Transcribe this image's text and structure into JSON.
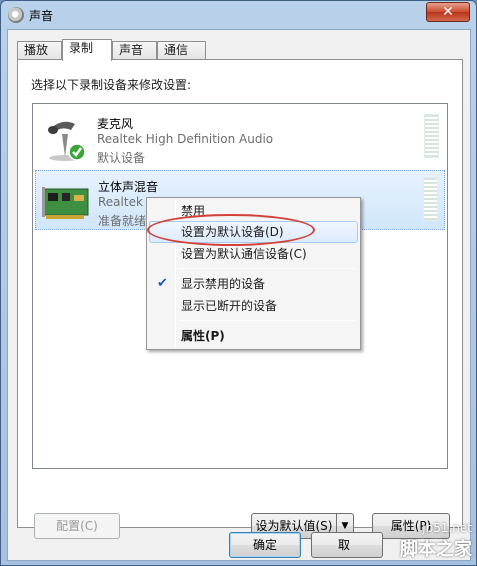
{
  "window": {
    "title": "声音",
    "close": "✕"
  },
  "tabs": [
    {
      "label": "播放",
      "active": false
    },
    {
      "label": "录制",
      "active": true
    },
    {
      "label": "声音",
      "active": false
    },
    {
      "label": "通信",
      "active": false
    }
  ],
  "instruction": "选择以下录制设备来修改设置:",
  "devices": [
    {
      "name": "麦克风",
      "driver": "Realtek High Definition Audio",
      "status": "默认设备",
      "icon": "microphone-icon"
    },
    {
      "name": "立体声混音",
      "driver": "Realtek",
      "status": "准备就绪",
      "icon": "sound-card-icon",
      "selected": true
    }
  ],
  "context_menu": {
    "items": [
      {
        "label": "禁用"
      },
      {
        "label": "设置为默认设备(D)",
        "hover": true
      },
      {
        "label": "设置为默认通信设备(C)"
      },
      {
        "label": "显示禁用的设备",
        "checked": true
      },
      {
        "label": "显示已断开的设备"
      },
      {
        "label": "属性(P)",
        "bold": true
      }
    ]
  },
  "buttons": {
    "configure": "配置(C)",
    "set_default": "设为默认值(S)",
    "properties": "属性(P)",
    "ok": "确定",
    "cancel": "取"
  },
  "watermark": {
    "line1": "jb51.net",
    "line2": "脚本之家"
  },
  "colors": {
    "annotation": "#d2413a",
    "accent": "#3c7fb1",
    "check": "#1e5aa8"
  }
}
